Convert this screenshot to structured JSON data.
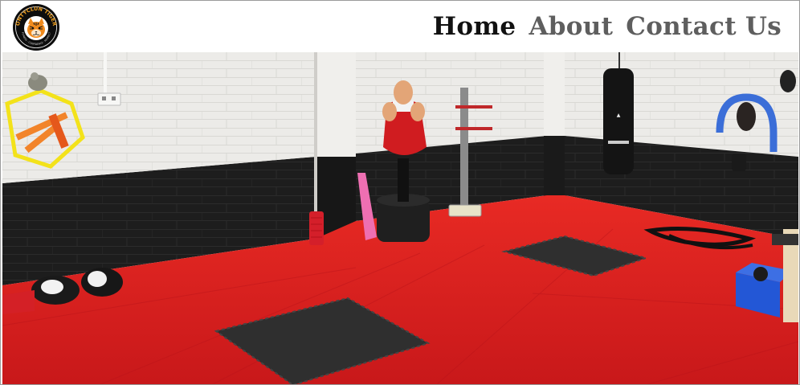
{
  "site": {
    "logo_icon": "tiger-club-badge",
    "logo_text": "PONTYCLUN TIGERS"
  },
  "nav": {
    "items": [
      {
        "label": "Home",
        "state": "active"
      },
      {
        "label": "About",
        "state": "inactive"
      },
      {
        "label": "Contact Us",
        "state": "inactive"
      }
    ]
  },
  "hero": {
    "subject": "martial-arts-training-room",
    "colors": {
      "floor": "#e01e1e",
      "wall_upper": "#ececea",
      "wall_lower": "#1c1c1c",
      "mat_dark": "#2f2f2f",
      "guard_red": "#d01c20"
    }
  }
}
